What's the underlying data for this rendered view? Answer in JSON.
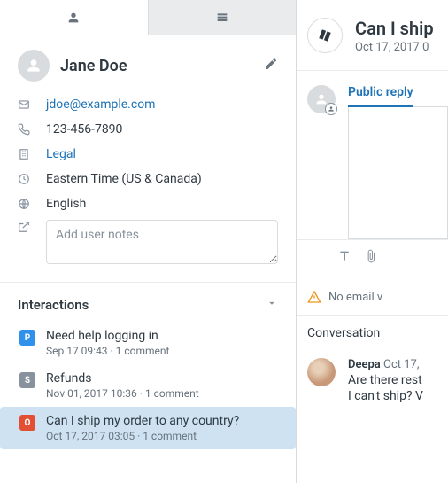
{
  "profile": {
    "name": "Jane Doe",
    "email": "jdoe@example.com",
    "phone": "123-456-7890",
    "org": "Legal",
    "timezone": "Eastern Time (US & Canada)",
    "language": "English",
    "notes_placeholder": "Add user notes"
  },
  "interactions": {
    "title": "Interactions",
    "items": [
      {
        "badge": "P",
        "title": "Need help logging in",
        "meta": "Sep 17 09:43 · 1 comment"
      },
      {
        "badge": "S",
        "title": "Refunds",
        "meta": "Nov 01, 2017 10:36 · 1 comment"
      },
      {
        "badge": "O",
        "title": "Can I ship my order to any country?",
        "meta": "Oct 17, 2017 03:05 · 1 comment"
      }
    ]
  },
  "thread": {
    "title": "Can I ship",
    "sub": "Oct 17, 2017 0",
    "reply_tab": "Public reply",
    "warn": "No email v",
    "conversation_label": "Conversation",
    "message": {
      "author": "Deepa",
      "time": "Oct 17,",
      "line1": "Are there rest",
      "line2": "I can't ship? V"
    }
  }
}
